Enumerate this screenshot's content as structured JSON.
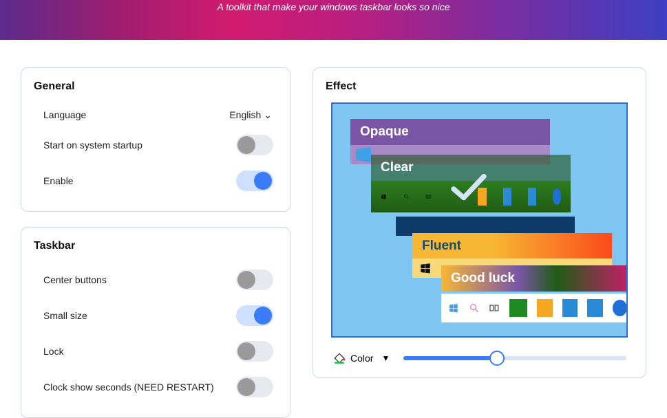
{
  "banner": {
    "subtitle": "A toolkit that make your windows taskbar looks so nice"
  },
  "general": {
    "title": "General",
    "language_label": "Language",
    "language_value": "English",
    "startup_label": "Start on system startup",
    "startup_on": false,
    "enable_label": "Enable",
    "enable_on": true
  },
  "taskbar": {
    "title": "Taskbar",
    "center_label": "Center buttons",
    "center_on": false,
    "small_label": "Small size",
    "small_on": true,
    "lock_label": "Lock",
    "lock_on": false,
    "clock_label": "Clock show seconds (NEED RESTART)",
    "clock_on": false
  },
  "effect": {
    "title": "Effect",
    "tiles": {
      "opaque": "Opaque",
      "clear": "Clear",
      "fluent": "Fluent",
      "goodluck": "Good luck"
    },
    "selected": "clear",
    "color_label": "Color",
    "slider_value": 42
  }
}
